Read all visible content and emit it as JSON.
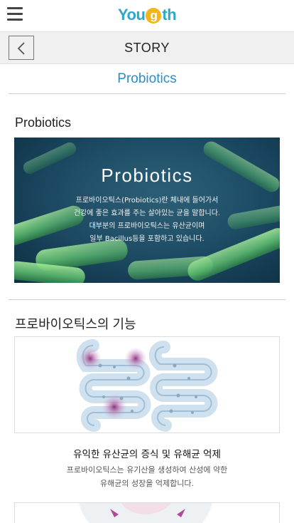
{
  "header": {
    "logo": {
      "prefix": "You",
      "g": "g",
      "suffix": "th"
    },
    "menu_icon": "hamburger-menu-icon"
  },
  "storybar": {
    "back_icon": "chevron-left-icon",
    "title": "STORY"
  },
  "page": {
    "title": "Probiotics"
  },
  "section1": {
    "title": "Probiotics",
    "hero": {
      "title": "Probiotics",
      "lines": [
        "프로바이오틱스(Probiotics)란 체내에 들어가서",
        "건강에 좋은 효과를 주는 살아있는 균을 말합니다.",
        "대부분의 프로바이오틱스는 유산균이며",
        "일부 Bacillus등을 포함하고 있습니다."
      ]
    }
  },
  "section2": {
    "title": "프로바이오틱스의 기능",
    "feature1": {
      "title": "유익한 유산균의 증식 및 유해균 억제",
      "desc": [
        "프로바이오틱스는 유기산을 생성하여 산성에 약한",
        "유해균의 성장을 억제합니다."
      ]
    }
  },
  "colors": {
    "accent": "#2b8ec4",
    "logo_blue": "#2ea8c9",
    "logo_yellow": "#f2b61b"
  }
}
